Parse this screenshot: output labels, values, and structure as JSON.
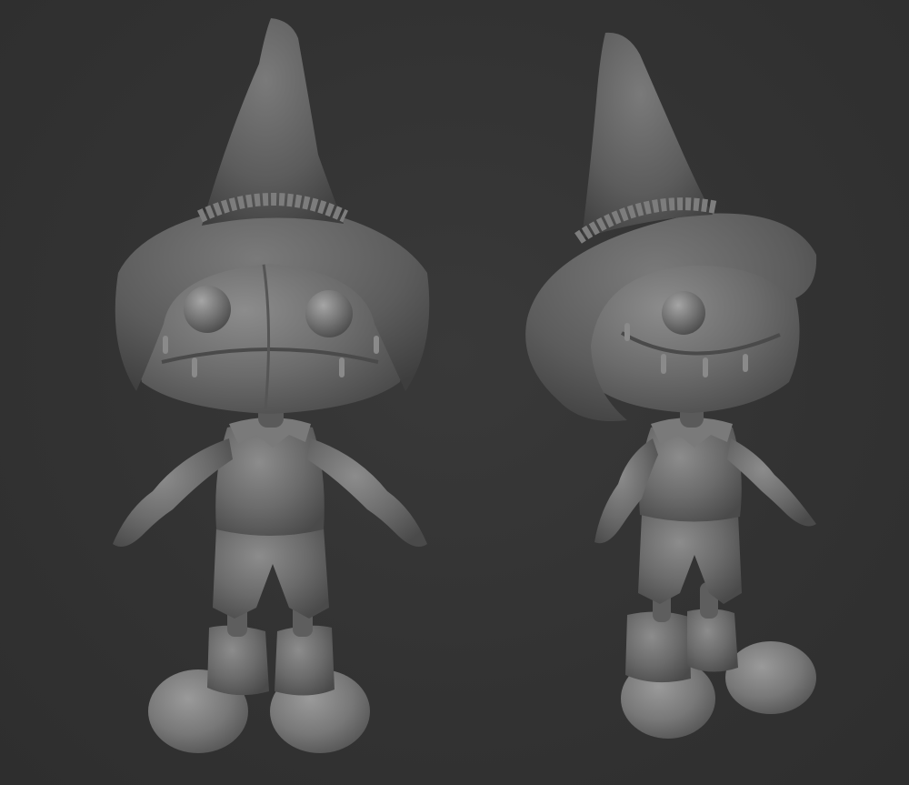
{
  "scene": {
    "background_color": "#333333",
    "model_color": "#6d6d6d",
    "shadow_color": "#4a4a4a",
    "highlight_color": "#8a8a8a",
    "views": [
      {
        "view": "front",
        "icon": "scarecrow-front-render"
      },
      {
        "view": "three-quarter",
        "icon": "scarecrow-three-quarter-render"
      }
    ]
  }
}
